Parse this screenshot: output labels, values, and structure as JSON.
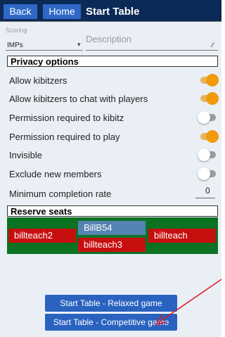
{
  "header": {
    "back_label": "Back",
    "home_label": "Home",
    "title": "Start Table"
  },
  "scoring": {
    "label": "Scoring",
    "value": "IMPs"
  },
  "description": {
    "placeholder": "Description"
  },
  "privacy": {
    "heading": "Privacy options",
    "options": [
      {
        "label": "Allow kibitzers",
        "on": true
      },
      {
        "label": "Allow kibitzers to chat with players",
        "on": true
      },
      {
        "label": "Permission required to kibitz",
        "on": false
      },
      {
        "label": "Permission required to play",
        "on": true
      },
      {
        "label": "Invisible",
        "on": false
      },
      {
        "label": "Exclude new members",
        "on": false
      }
    ],
    "min_rate_label": "Minimum completion rate",
    "min_rate_value": "0"
  },
  "reserve": {
    "heading": "Reserve seats",
    "seats": {
      "west": "billteach2",
      "north": "BillB54",
      "south": "billteach3",
      "east": "billteach"
    }
  },
  "buttons": {
    "relaxed": "Start Table - Relaxed game",
    "competitive": "Start Table - Competitive game"
  },
  "colors": {
    "header_bg": "#0c2a56",
    "button_blue": "#2a62c0",
    "toggle_on": "#f19b0c",
    "seat_red": "#c70f0f",
    "seat_blue": "#5583b2",
    "table_green": "#0b7222",
    "annotation_arrow": "#e0151d"
  }
}
